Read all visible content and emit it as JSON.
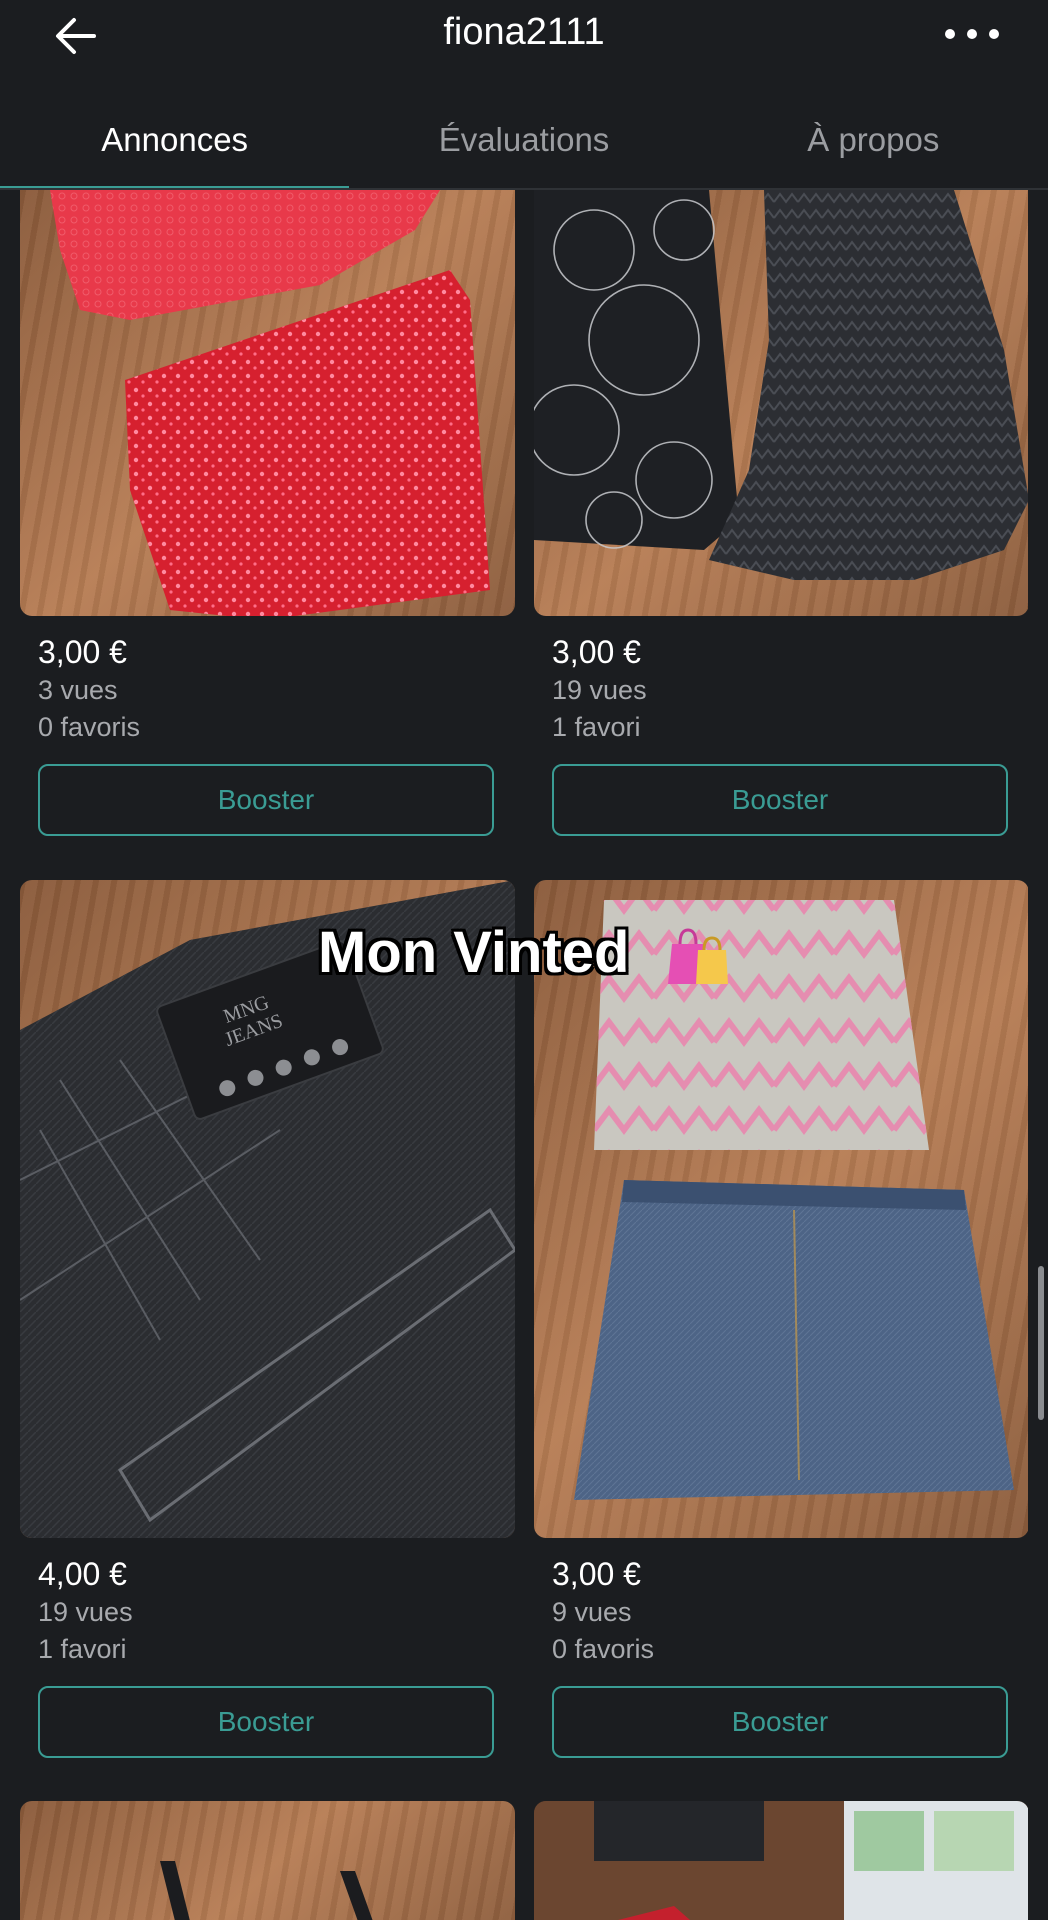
{
  "header": {
    "title": "fiona2111",
    "back_icon": "arrow-left-icon",
    "more_icon": "more-horizontal-icon"
  },
  "tabs": [
    {
      "label": "Annonces",
      "active": true
    },
    {
      "label": "Évaluations",
      "active": false
    },
    {
      "label": "À propos",
      "active": false
    }
  ],
  "listings": [
    {
      "price": "3,00 €",
      "views": "3 vues",
      "favorites": "0 favoris",
      "button": "Booster",
      "image": "red-tops-on-wood"
    },
    {
      "price": "3,00 €",
      "views": "19 vues",
      "favorites": "1 favori",
      "button": "Booster",
      "image": "black-dresses-on-wood"
    },
    {
      "price": "4,00 €",
      "views": "19 vues",
      "favorites": "1 favori",
      "button": "Booster",
      "image": "black-mng-jeans-closeup"
    },
    {
      "price": "3,00 €",
      "views": "9 vues",
      "favorites": "0 favoris",
      "button": "Booster",
      "image": "two-denim-skirts-on-wood"
    }
  ],
  "overlay": {
    "text": "Mon Vinted",
    "icon": "shopping-bags-icon",
    "brand_patch_text": "MNG JEANS"
  },
  "colors": {
    "background": "#1b1d20",
    "accent": "#3a9c94",
    "muted_text": "#a8aaae"
  }
}
